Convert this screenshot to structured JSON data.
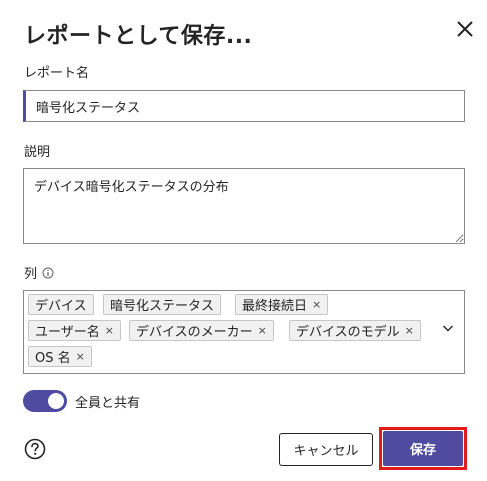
{
  "dialog": {
    "title": "レポートとして保存...",
    "close_icon": "close-icon"
  },
  "name_field": {
    "label": "レポート名",
    "value": "暗号化ステータス"
  },
  "description_field": {
    "label": "説明",
    "value": "デバイス暗号化ステータスの分布"
  },
  "columns_field": {
    "label": "列",
    "info_icon": "info-icon",
    "chips": [
      {
        "label": "デバイス",
        "removable": false
      },
      {
        "label": "暗号化ステータス",
        "removable": false
      },
      {
        "label": "最終接続日",
        "removable": true
      },
      {
        "label": "ユーザー名",
        "removable": true
      },
      {
        "label": "デバイスのメーカー",
        "removable": true
      },
      {
        "label": "デバイスのモデル",
        "removable": true
      },
      {
        "label": "OS 名",
        "removable": true
      }
    ],
    "remove_glyph": "×",
    "dropdown_icon": "chevron-down-icon"
  },
  "share_toggle": {
    "label": "全員と共有",
    "on": true
  },
  "footer": {
    "help_icon": "help-icon",
    "cancel_label": "キャンセル",
    "save_label": "保存"
  },
  "colors": {
    "accent": "#4f4ba0",
    "highlight": "#e21b1b"
  }
}
